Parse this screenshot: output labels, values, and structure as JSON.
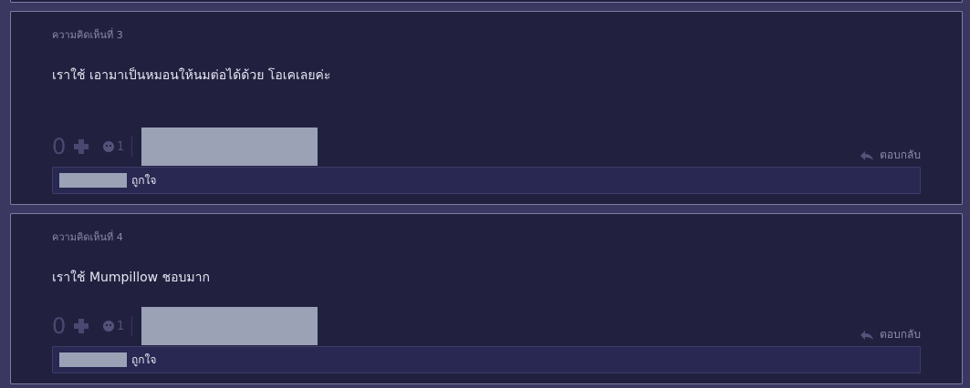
{
  "comments": [
    {
      "number_label": "ความคิดเห็นที่ 3",
      "text": "เราใช้ เอามาเป็นหมอนให้นมต่อได้ด้วย โอเคเลยค่ะ",
      "votes": "0",
      "emotion_count": "1",
      "reply_label": "ตอบกลับ",
      "like_label": "ถูกใจ"
    },
    {
      "number_label": "ความคิดเห็นที่ 4",
      "text": "เราใช้ Mumpillow ชอบมาก",
      "votes": "0",
      "emotion_count": "1",
      "reply_label": "ตอบกลับ",
      "like_label": "ถูกใจ"
    }
  ]
}
